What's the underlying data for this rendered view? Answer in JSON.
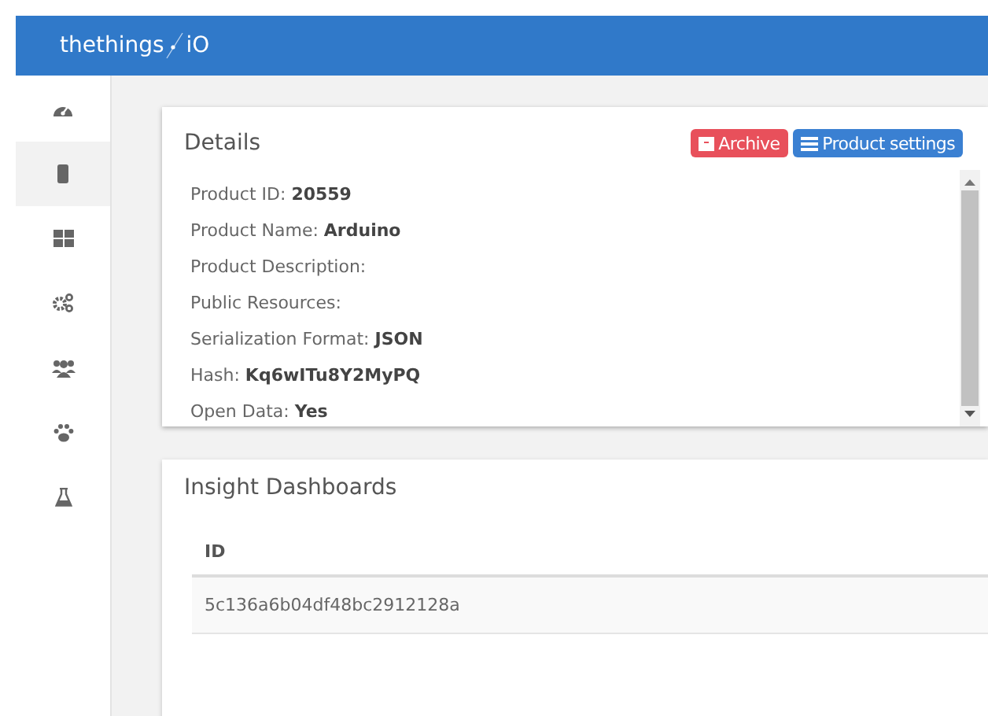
{
  "header": {
    "logo_left": "thethings",
    "logo_right": "iO"
  },
  "sidebar": {
    "items": [
      {
        "kind": "dashboard",
        "selected": false
      },
      {
        "kind": "chip",
        "selected": true
      },
      {
        "kind": "grid",
        "selected": false
      },
      {
        "kind": "gears",
        "selected": false
      },
      {
        "kind": "users",
        "selected": false
      },
      {
        "kind": "paw",
        "selected": false
      },
      {
        "kind": "flask",
        "selected": false
      }
    ]
  },
  "details": {
    "title": "Details",
    "buttons": [
      {
        "kind": "archive",
        "label": "Archive"
      },
      {
        "kind": "settings",
        "label": "Product settings"
      }
    ],
    "fields": [
      {
        "label": "Product ID:",
        "value": "20559"
      },
      {
        "label": "Product Name:",
        "value": "Arduino"
      },
      {
        "label": "Product Description:"
      },
      {
        "label": "Public Resources:"
      },
      {
        "label": "Serialization Format:",
        "value": "JSON"
      },
      {
        "label": "Hash:",
        "value": "Kq6wITu8Y2MyPQ"
      },
      {
        "label": "Open Data:",
        "value": "Yes"
      }
    ]
  },
  "insight_dashboards": {
    "title": "Insight Dashboards",
    "table": {
      "columns": [
        "ID"
      ],
      "rows": [
        [
          "5c136a6b04df48bc2912128a"
        ]
      ]
    }
  }
}
